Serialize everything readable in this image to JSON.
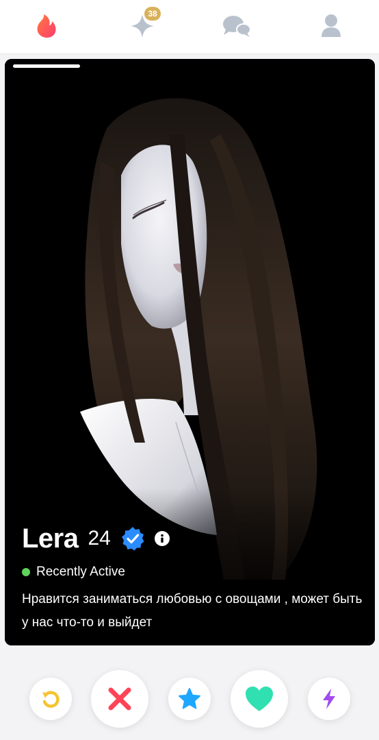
{
  "nav": {
    "items": [
      {
        "name": "flame-icon",
        "color": "#ff5a4e"
      },
      {
        "name": "sparkle-icon",
        "color": "#b9c2cc",
        "badge": "38"
      },
      {
        "name": "chat-bubbles-icon",
        "color": "#b9c2cc"
      },
      {
        "name": "profile-icon",
        "color": "#b9c2cc"
      }
    ]
  },
  "card": {
    "photo_count": 1,
    "current_photo": 1,
    "profile": {
      "name": "Lera",
      "age": "24",
      "verified": true,
      "status": "Recently Active",
      "bio": "Нравится заниматься любовью с овощами , может быть у нас что-то и выйдет"
    }
  },
  "actions": [
    {
      "name": "rewind-button",
      "icon": "rewind-icon",
      "color": "#f4c431"
    },
    {
      "name": "nope-button",
      "icon": "x-icon",
      "color": "#ff4458"
    },
    {
      "name": "super-like-button",
      "icon": "star-icon",
      "color": "#1fa7ff"
    },
    {
      "name": "like-button",
      "icon": "heart-icon",
      "color": "#30e0b0"
    },
    {
      "name": "boost-button",
      "icon": "bolt-icon",
      "color": "#a04cf0"
    }
  ]
}
